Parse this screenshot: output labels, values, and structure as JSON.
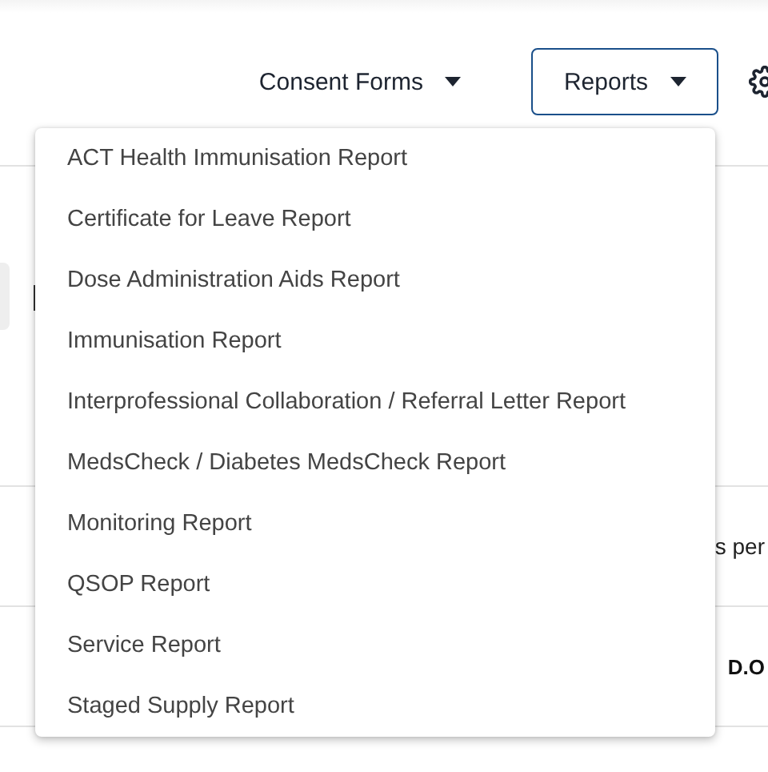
{
  "toolbar": {
    "consent_forms": {
      "label": "Consent Forms",
      "expanded": false
    },
    "reports": {
      "label": "Reports",
      "expanded": true
    }
  },
  "reports_menu": [
    {
      "label": "ACT Health Immunisation Report"
    },
    {
      "label": "Certificate for Leave Report"
    },
    {
      "label": "Dose Administration Aids Report"
    },
    {
      "label": "Immunisation Report"
    },
    {
      "label": "Interprofessional Collaboration / Referral Letter Report"
    },
    {
      "label": "MedsCheck / Diabetes MedsCheck Report"
    },
    {
      "label": "Monitoring Report"
    },
    {
      "label": "QSOP Report"
    },
    {
      "label": "Service Report"
    },
    {
      "label": "Staged Supply Report"
    }
  ],
  "background": {
    "rows_text": "s per",
    "column_header": "D.O"
  }
}
